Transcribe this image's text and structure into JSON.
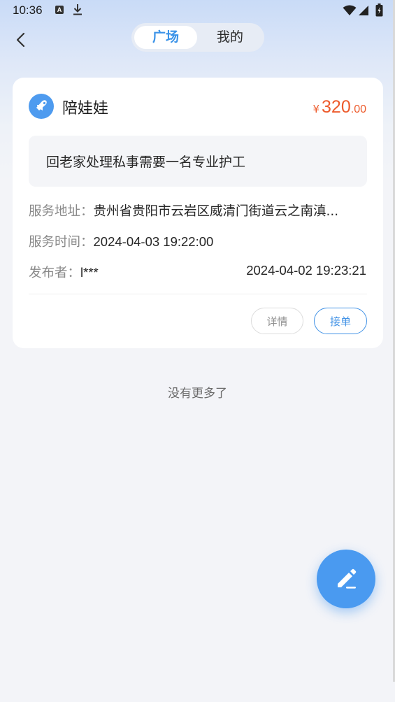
{
  "status_bar": {
    "time": "10:36",
    "icons": [
      "notification-a-icon",
      "download-icon",
      "wifi-icon",
      "signal-icon",
      "battery-icon"
    ]
  },
  "header": {
    "back_icon": "back-chevron-icon",
    "tabs": [
      {
        "label": "广场",
        "active": true
      },
      {
        "label": "我的",
        "active": false
      }
    ]
  },
  "order": {
    "service_icon": "service-badge-icon",
    "service_name": "陪娃娃",
    "price_symbol": "¥",
    "price_integer": "320",
    "price_decimal": ".00",
    "description": "回老家处理私事需要一名专业护工",
    "address_label": "服务地址：",
    "address": "贵州省贵阳市云岩区威清门街道云之南滇...",
    "time_label": "服务时间：",
    "service_time": "2024-04-03 19:22:00",
    "publisher_label": "发布者：",
    "publisher": "l***",
    "publish_time": "2024-04-02 19:23:21",
    "detail_button": "详情",
    "accept_button": "接单"
  },
  "list_footer": "没有更多了",
  "fab_icon": "edit-pen-icon",
  "colors": {
    "accent": "#4393e6",
    "price": "#ed5a2b",
    "background": "#f3f4f8"
  }
}
